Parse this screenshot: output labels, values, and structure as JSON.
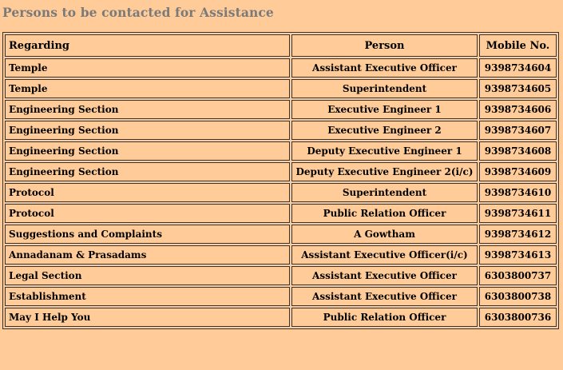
{
  "page": {
    "title": "Persons to be contacted for Assistance"
  },
  "table": {
    "headers": {
      "regarding": "Regarding",
      "person": "Person",
      "mobile": "Mobile No."
    },
    "rows": [
      {
        "regarding": "Temple",
        "person": "Assistant Executive Officer",
        "mobile": "9398734604"
      },
      {
        "regarding": "Temple",
        "person": "Superintendent",
        "mobile": "9398734605"
      },
      {
        "regarding": "Engineering Section",
        "person": "Executive Engineer 1",
        "mobile": "9398734606"
      },
      {
        "regarding": "Engineering Section",
        "person": "Executive Engineer 2",
        "mobile": "9398734607"
      },
      {
        "regarding": "Engineering Section",
        "person": "Deputy Executive Engineer 1",
        "mobile": "9398734608"
      },
      {
        "regarding": "Engineering Section",
        "person": "Deputy Executive Engineer 2(i/c)",
        "mobile": "9398734609"
      },
      {
        "regarding": "Protocol",
        "person": "Superintendent",
        "mobile": "9398734610"
      },
      {
        "regarding": "Protocol",
        "person": "Public Relation Officer",
        "mobile": "9398734611"
      },
      {
        "regarding": "Suggestions and Complaints",
        "person": "A Gowtham",
        "mobile": "9398734612"
      },
      {
        "regarding": "Annadanam & Prasadams",
        "person": "Assistant Executive Officer(i/c)",
        "mobile": "9398734613"
      },
      {
        "regarding": "Legal Section",
        "person": "Assistant Executive Officer",
        "mobile": "6303800737"
      },
      {
        "regarding": "Establishment",
        "person": "Assistant Executive Officer",
        "mobile": "6303800738"
      },
      {
        "regarding": "May I Help You",
        "person": "Public Relation Officer",
        "mobile": "6303800736"
      }
    ]
  },
  "colors": {
    "background": "#ffcc99",
    "title": "#7a7a7a",
    "border": "#333333"
  }
}
